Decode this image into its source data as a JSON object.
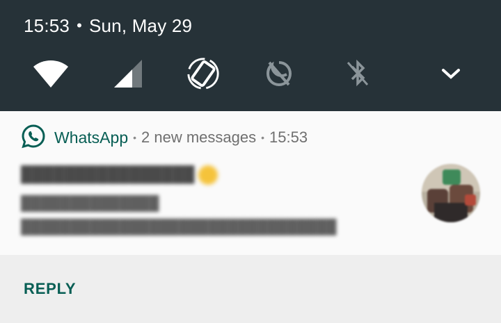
{
  "status_bar": {
    "time": "15:53",
    "separator": "•",
    "date": "Sun, May 29"
  },
  "quick_settings": {
    "icons": [
      "wifi-icon",
      "cellular-signal-icon",
      "auto-rotate-icon",
      "do-not-disturb-off-icon",
      "bluetooth-off-icon",
      "expand-chevron-icon"
    ]
  },
  "notification": {
    "app_icon": "whatsapp-icon",
    "app_name": "WhatsApp",
    "separator": "•",
    "summary": "2 new messages",
    "time": "15:53",
    "sender_redacted": "████████████████",
    "message_1_redacted": "██████████████",
    "message_2_redacted": "████████████████████████████████",
    "avatar": "contact-avatar"
  },
  "actions": {
    "reply_label": "REPLY"
  },
  "colors": {
    "shade_background": "#263238",
    "whatsapp_green": "#075e54",
    "card_background": "#fafafa",
    "actions_background": "#eeeeee"
  }
}
